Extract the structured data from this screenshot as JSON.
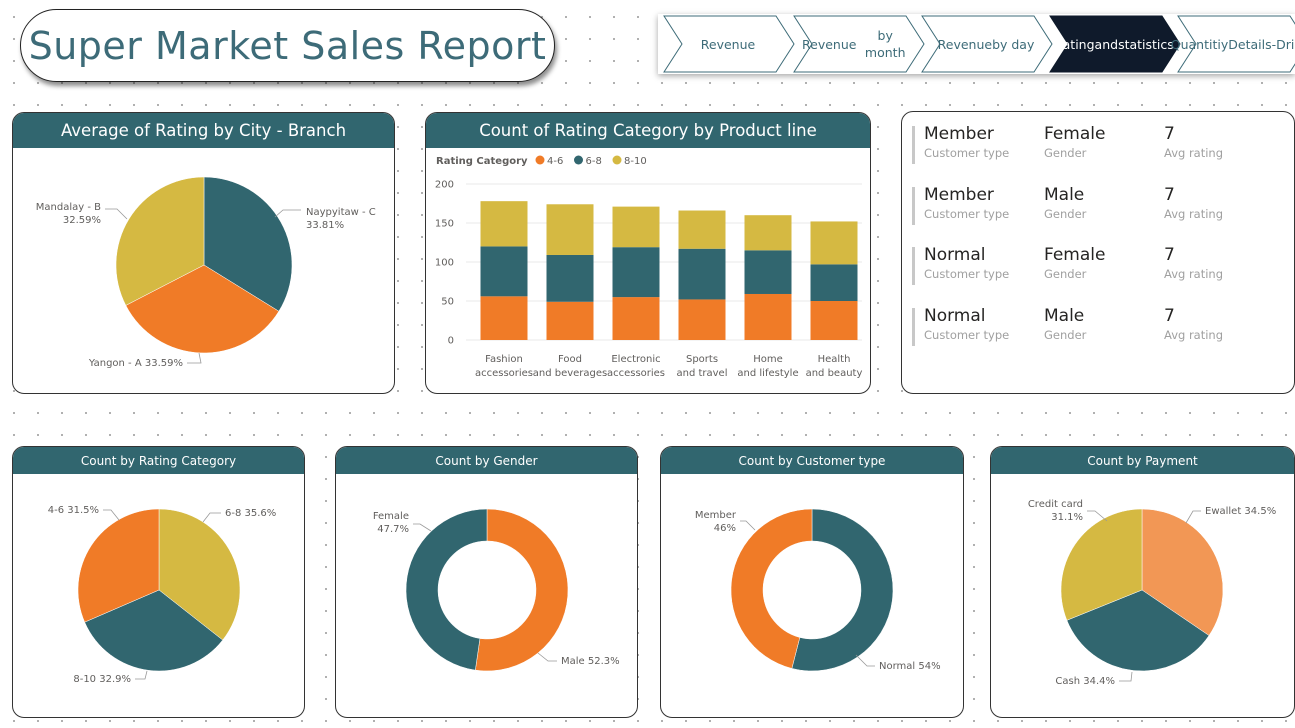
{
  "header": {
    "title": "Super Market Sales Report"
  },
  "nav": {
    "items": [
      {
        "lines": [
          "Revenue"
        ],
        "active": false
      },
      {
        "lines": [
          "Revenue",
          "by month"
        ],
        "active": false
      },
      {
        "lines": [
          "Revenue",
          "by day"
        ],
        "active": false
      },
      {
        "lines": [
          "Rating",
          "and",
          "statistics"
        ],
        "active": true
      },
      {
        "lines": [
          "Quantitiy",
          "Details-",
          "Drill..."
        ],
        "active": false
      }
    ]
  },
  "colors": {
    "header_bg": "#31666f",
    "orange": "#f07b27",
    "teal": "#31666f",
    "yellow": "#d5b942",
    "light_orange": "#f29755",
    "nav_active": "#0f1a2b"
  },
  "avg_rating_card": {
    "title": "Average of Rating by City - Branch"
  },
  "count_rating_card": {
    "title": "Count of Rating Category by Product line"
  },
  "stats": {
    "rows": [
      {
        "customer_type": "Member",
        "gender": "Female",
        "avg_rating": "7"
      },
      {
        "customer_type": "Member",
        "gender": "Male",
        "avg_rating": "7"
      },
      {
        "customer_type": "Normal",
        "gender": "Female",
        "avg_rating": "7"
      },
      {
        "customer_type": "Normal",
        "gender": "Male",
        "avg_rating": "7"
      }
    ],
    "labels": {
      "customer_type": "Customer type",
      "gender": "Gender",
      "avg_rating": "Avg rating"
    }
  },
  "rating_category_card": {
    "title": "Count by Rating Category"
  },
  "gender_card": {
    "title": "Count by Gender"
  },
  "customer_type_card": {
    "title": "Count by Customer type"
  },
  "payment_card": {
    "title": "Count by Payment"
  },
  "chart_data": [
    {
      "type": "pie",
      "title": "Average of Rating by City - Branch",
      "slices": [
        {
          "label": "Naypyitaw - C",
          "value": 33.81,
          "display": "33.81%",
          "color": "#31666f"
        },
        {
          "label": "Yangon - A",
          "value": 33.59,
          "display": "33.59%",
          "color": "#f07b27"
        },
        {
          "label": "Mandalay - B",
          "value": 32.59,
          "display": "32.59%",
          "color": "#d5b942"
        }
      ]
    },
    {
      "type": "bar",
      "stacked": true,
      "title": "Count of Rating Category by Product line",
      "legend_title": "Rating Category",
      "categories": [
        "Fashion accessories",
        "Food and beverages",
        "Electronic accessories",
        "Sports and travel",
        "Home and lifestyle",
        "Health and beauty"
      ],
      "series": [
        {
          "name": "4-6",
          "color": "#f07b27",
          "values": [
            56,
            49,
            55,
            52,
            59,
            50
          ]
        },
        {
          "name": "6-8",
          "color": "#31666f",
          "values": [
            64,
            60,
            64,
            65,
            56,
            47
          ]
        },
        {
          "name": "8-10",
          "color": "#d5b942",
          "values": [
            58,
            65,
            52,
            49,
            45,
            55
          ]
        }
      ],
      "yticks": [
        0,
        50,
        100,
        150,
        200
      ],
      "ylim": [
        0,
        200
      ],
      "grid": true,
      "legend": "top-left"
    },
    {
      "type": "pie",
      "title": "Count by Rating Category",
      "slices": [
        {
          "label": "6-8",
          "value": 35.6,
          "display": "6-8 35.6%",
          "color": "#d5b942"
        },
        {
          "label": "8-10",
          "value": 32.9,
          "display": "8-10 32.9%",
          "color": "#31666f"
        },
        {
          "label": "4-6",
          "value": 31.5,
          "display": "4-6 31.5%",
          "color": "#f07b27"
        }
      ]
    },
    {
      "type": "pie",
      "donut": true,
      "title": "Count by Gender",
      "slices": [
        {
          "label": "Male",
          "value": 52.3,
          "display": "Male 52.3%",
          "color": "#f07b27"
        },
        {
          "label": "Female",
          "value": 47.7,
          "display": "Female 47.7%",
          "color": "#31666f"
        }
      ]
    },
    {
      "type": "pie",
      "donut": true,
      "title": "Count by Customer type",
      "slices": [
        {
          "label": "Normal",
          "value": 54,
          "display": "Normal 54%",
          "color": "#31666f"
        },
        {
          "label": "Member",
          "value": 46,
          "display": "Member 46%",
          "color": "#f07b27"
        }
      ]
    },
    {
      "type": "pie",
      "title": "Count by Payment",
      "slices": [
        {
          "label": "Ewallet",
          "value": 34.5,
          "display": "Ewallet 34.5%",
          "color": "#f29755"
        },
        {
          "label": "Cash",
          "value": 34.4,
          "display": "Cash 34.4%",
          "color": "#31666f"
        },
        {
          "label": "Credit card",
          "value": 31.1,
          "display": "Credit card 31.1%",
          "color": "#d5b942"
        }
      ]
    }
  ]
}
